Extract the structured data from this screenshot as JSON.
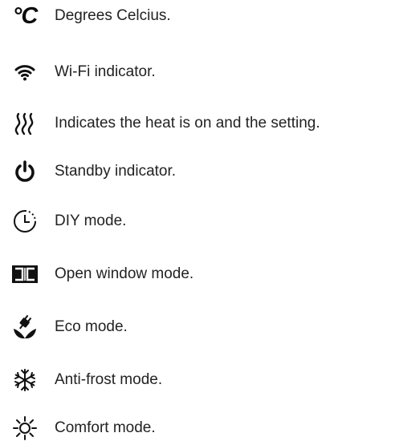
{
  "items": [
    {
      "icon": "degrees-celsius-icon",
      "symbol": "°C",
      "label": "Degrees Celcius."
    },
    {
      "icon": "wifi-icon",
      "label": "Wi-Fi indicator."
    },
    {
      "icon": "heat-waves-icon",
      "label": "Indicates the heat is on and the setting."
    },
    {
      "icon": "power-standby-icon",
      "label": "Standby indicator."
    },
    {
      "icon": "clock-icon",
      "label": "DIY mode."
    },
    {
      "icon": "open-window-icon",
      "label": "Open window mode."
    },
    {
      "icon": "eco-plug-leaf-icon",
      "label": "Eco mode."
    },
    {
      "icon": "snowflake-icon",
      "label": "Anti-frost mode."
    },
    {
      "icon": "sun-icon",
      "label": "Comfort mode."
    }
  ],
  "colors": {
    "text": "#222222",
    "icon": "#111111",
    "background": "#ffffff"
  }
}
